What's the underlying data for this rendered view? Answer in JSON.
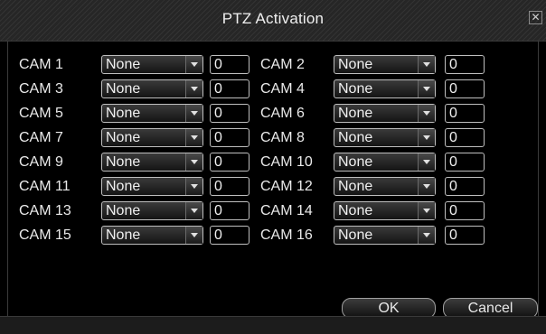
{
  "dialog": {
    "title": "PTZ Activation",
    "close_icon": "close-icon",
    "cameras": [
      {
        "label": "CAM 1",
        "mode": "None",
        "value": "0"
      },
      {
        "label": "CAM 2",
        "mode": "None",
        "value": "0"
      },
      {
        "label": "CAM 3",
        "mode": "None",
        "value": "0"
      },
      {
        "label": "CAM 4",
        "mode": "None",
        "value": "0"
      },
      {
        "label": "CAM 5",
        "mode": "None",
        "value": "0"
      },
      {
        "label": "CAM 6",
        "mode": "None",
        "value": "0"
      },
      {
        "label": "CAM 7",
        "mode": "None",
        "value": "0"
      },
      {
        "label": "CAM 8",
        "mode": "None",
        "value": "0"
      },
      {
        "label": "CAM 9",
        "mode": "None",
        "value": "0"
      },
      {
        "label": "CAM 10",
        "mode": "None",
        "value": "0"
      },
      {
        "label": "CAM 11",
        "mode": "None",
        "value": "0"
      },
      {
        "label": "CAM 12",
        "mode": "None",
        "value": "0"
      },
      {
        "label": "CAM 13",
        "mode": "None",
        "value": "0"
      },
      {
        "label": "CAM 14",
        "mode": "None",
        "value": "0"
      },
      {
        "label": "CAM 15",
        "mode": "None",
        "value": "0"
      },
      {
        "label": "CAM 16",
        "mode": "None",
        "value": "0"
      }
    ],
    "ok_label": "OK",
    "cancel_label": "Cancel"
  },
  "colors": {
    "background": "#000000",
    "text": "#f0f0f0",
    "border": "#bfbfbf"
  }
}
